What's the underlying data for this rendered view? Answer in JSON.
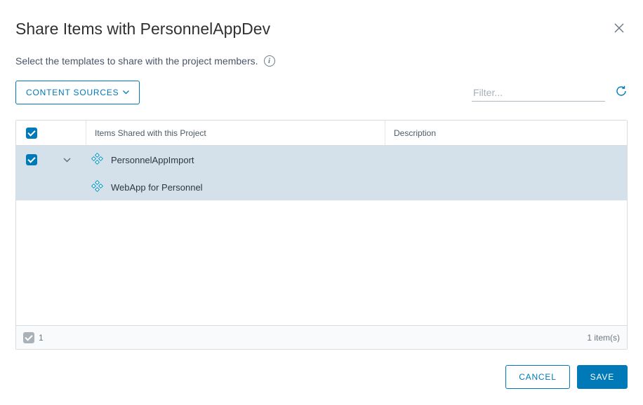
{
  "dialog": {
    "title": "Share Items with PersonnelAppDev",
    "subtitle": "Select the templates to share with the project members."
  },
  "toolbar": {
    "content_sources_label": "CONTENT SOURCES",
    "filter_placeholder": "Filter..."
  },
  "table": {
    "columns": {
      "items": "Items Shared with this Project",
      "description": "Description"
    },
    "groups": [
      {
        "name": "PersonnelAppImport",
        "checked": true,
        "expanded": true,
        "children": [
          {
            "name": "WebApp for Personnel"
          }
        ]
      }
    ],
    "footer": {
      "selected_count": "1",
      "summary": "1 item(s)"
    }
  },
  "actions": {
    "cancel": "CANCEL",
    "save": "SAVE"
  }
}
